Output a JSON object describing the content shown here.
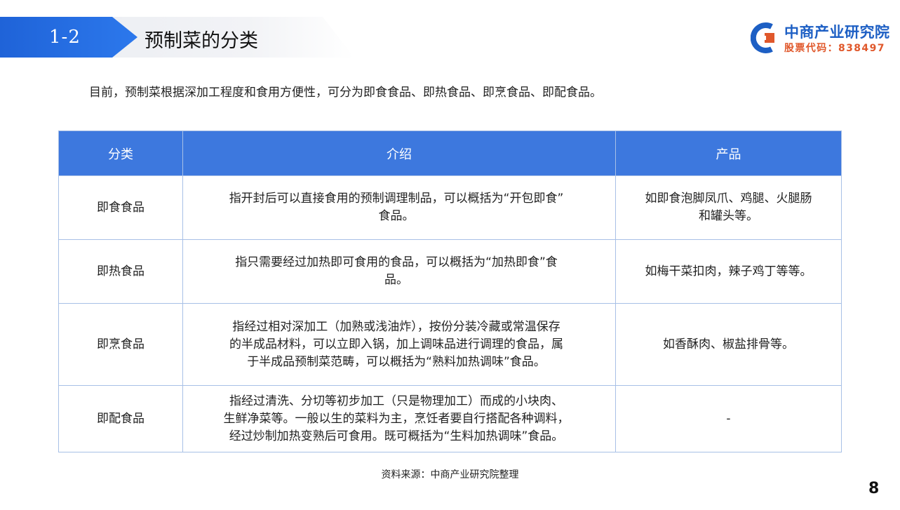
{
  "header": {
    "section_number": "1-2",
    "section_title": "预制菜的分类"
  },
  "logo": {
    "name": "中商产业研究院",
    "stock_code": "股票代码：838497",
    "colors": {
      "blue": "#1d5fc4",
      "orange": "#e0582b"
    }
  },
  "intro": "目前，预制菜根据深加工程度和食用方便性，可分为即食食品、即热食品、即烹食品、即配食品。",
  "table": {
    "headers": [
      "分类",
      "介绍",
      "产品"
    ],
    "rows": [
      {
        "category": "即食食品",
        "description": [
          "指开封后可以直接食用的预制调理制品，可以概括为“开包即食”",
          "食品。"
        ],
        "products": [
          "如即食泡脚凤爪、鸡腿、火腿肠",
          "和罐头等。"
        ]
      },
      {
        "category": "即热食品",
        "description": [
          "指只需要经过加热即可食用的食品，可以概括为“加热即食”食",
          "品。"
        ],
        "products": [
          "如梅干菜扣肉，辣子鸡丁等等。"
        ]
      },
      {
        "category": "即烹食品",
        "description": [
          "指经过相对深加工（加熟或浅油炸），按份分装冷藏或常温保存",
          "的半成品材料，可以立即入锅，加上调味品进行调理的食品，属",
          "于半成品预制菜范畴，可以概括为“熟料加热调味”食品。"
        ],
        "products": [
          "如香酥肉、椒盐排骨等。"
        ]
      },
      {
        "category": "即配食品",
        "description": [
          "指经过清洗、分切等初步加工（只是物理加工）而成的小块肉、",
          "生鲜净菜等。一般以生的菜料为主，烹饪者要自行搭配各种调料，",
          "经过炒制加热变熟后可食用。既可概括为“生料加热调味”食品。"
        ],
        "products": [
          "-"
        ]
      }
    ],
    "colors": {
      "header_bg": "#3d78de",
      "border": "#a8c0e6"
    }
  },
  "source": "资料来源：中商产业研究院整理",
  "page_number": "8"
}
